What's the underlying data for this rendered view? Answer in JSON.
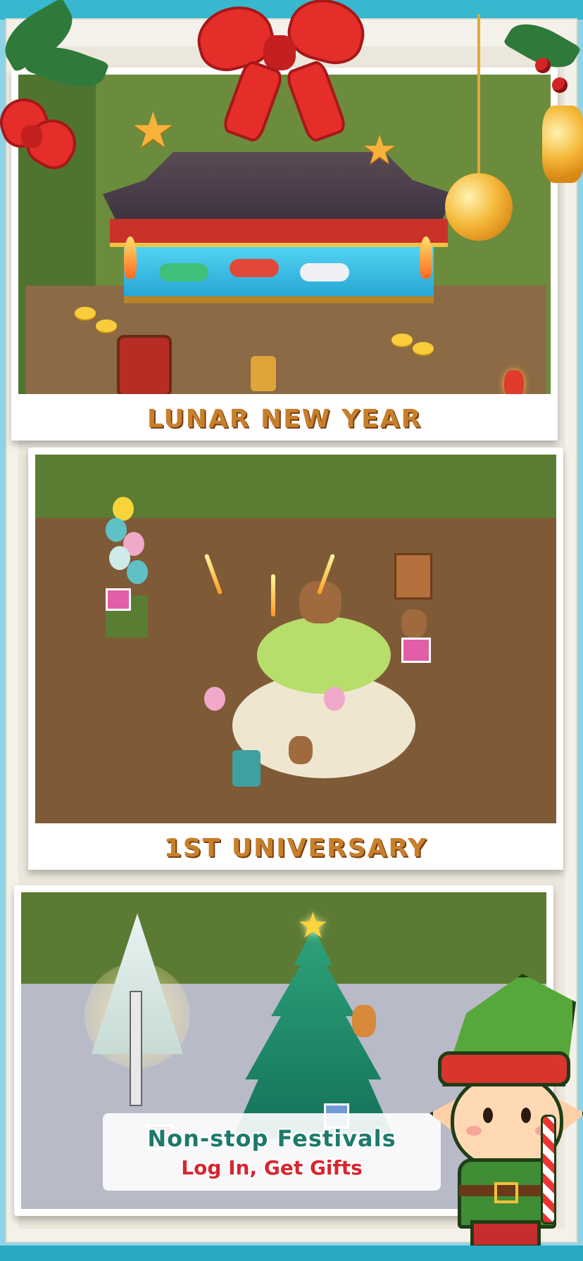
{
  "panels": [
    {
      "caption": "LUNAR NEW YEAR"
    },
    {
      "caption": "1ST UNIVERSARY"
    },
    {
      "caption": ""
    }
  ],
  "banner": {
    "title": "Non-stop Festivals",
    "subtitle": "Log In, Get Gifts"
  },
  "colors": {
    "caption_text": "#c87f2c",
    "banner_title": "#1d7a6c",
    "banner_subtitle": "#d6262f",
    "sky_strip": "#37b8cf",
    "bow_red": "#e52d2a"
  },
  "icons": {
    "bow": "red-ribbon-bow-icon",
    "star": "gold-star-icon",
    "ornament": "gold-ornament-icon",
    "holly": "holly-leaf-icon",
    "mascot": "elf-mascot"
  }
}
